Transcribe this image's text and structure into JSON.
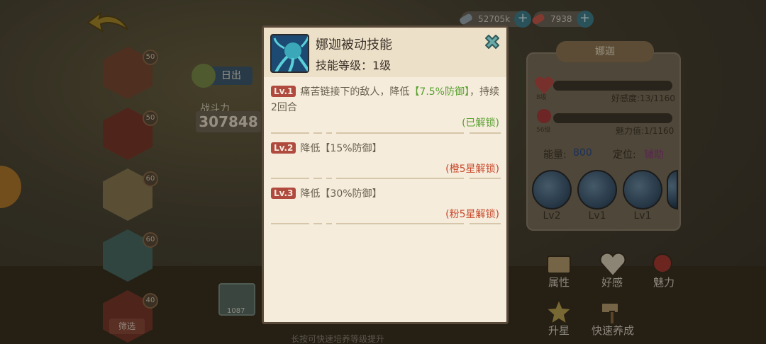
{
  "resources": [
    {
      "value": "52705k",
      "plus": "+"
    },
    {
      "value": "7938",
      "plus": "+"
    }
  ],
  "heroes": [
    {
      "level": "50"
    },
    {
      "level": "50"
    },
    {
      "level": "60"
    },
    {
      "level": "60"
    },
    {
      "level": "40"
    }
  ],
  "sun_label": "日出",
  "power": {
    "label": "战斗力",
    "value": "307848"
  },
  "filter_label": "筛选",
  "card_count": "1087",
  "bottom_tip": "长按可快速培养等级提升",
  "right_panel": {
    "name": "娜迦",
    "affinity_lv": "8级",
    "affinity_text": "好感度:13/1160",
    "charm_lv": "56级",
    "charm_text": "魅力值:1/1160",
    "energy_label": "能量:",
    "energy_value": "800",
    "role_label": "定位:",
    "role_value": "辅助",
    "skills": [
      {
        "label": "Lv2"
      },
      {
        "label": "Lv1"
      },
      {
        "label": "Lv1"
      }
    ],
    "menu": [
      {
        "label": "属性",
        "icon": "book-icon"
      },
      {
        "label": "好感",
        "icon": "heart-icon"
      },
      {
        "label": "魅力",
        "icon": "rose-icon"
      },
      {
        "label": "升星",
        "icon": "star-icon"
      },
      {
        "label": "快速养成",
        "icon": "hammer-icon"
      }
    ]
  },
  "dialog": {
    "title": "娜迦被动技能",
    "level_text": "技能等级：1级",
    "levels": [
      {
        "badge": "Lv.1",
        "text_before": "痛苦链接下的敌人，降低",
        "highlight": "【7.5%防御】",
        "text_after": "，持续2回合",
        "status": "(已解锁)"
      },
      {
        "badge": "Lv.2",
        "text": "降低【15%防御】",
        "status": "(橙5星解锁)"
      },
      {
        "badge": "Lv.3",
        "text": "降低【30%防御】",
        "status": "(粉5星解锁)"
      }
    ]
  },
  "colors": {
    "unlocked": "#58a030",
    "locked": "#c84a2c",
    "badge": "#b04a3e",
    "dialog_bg": "#f6ecdc"
  }
}
